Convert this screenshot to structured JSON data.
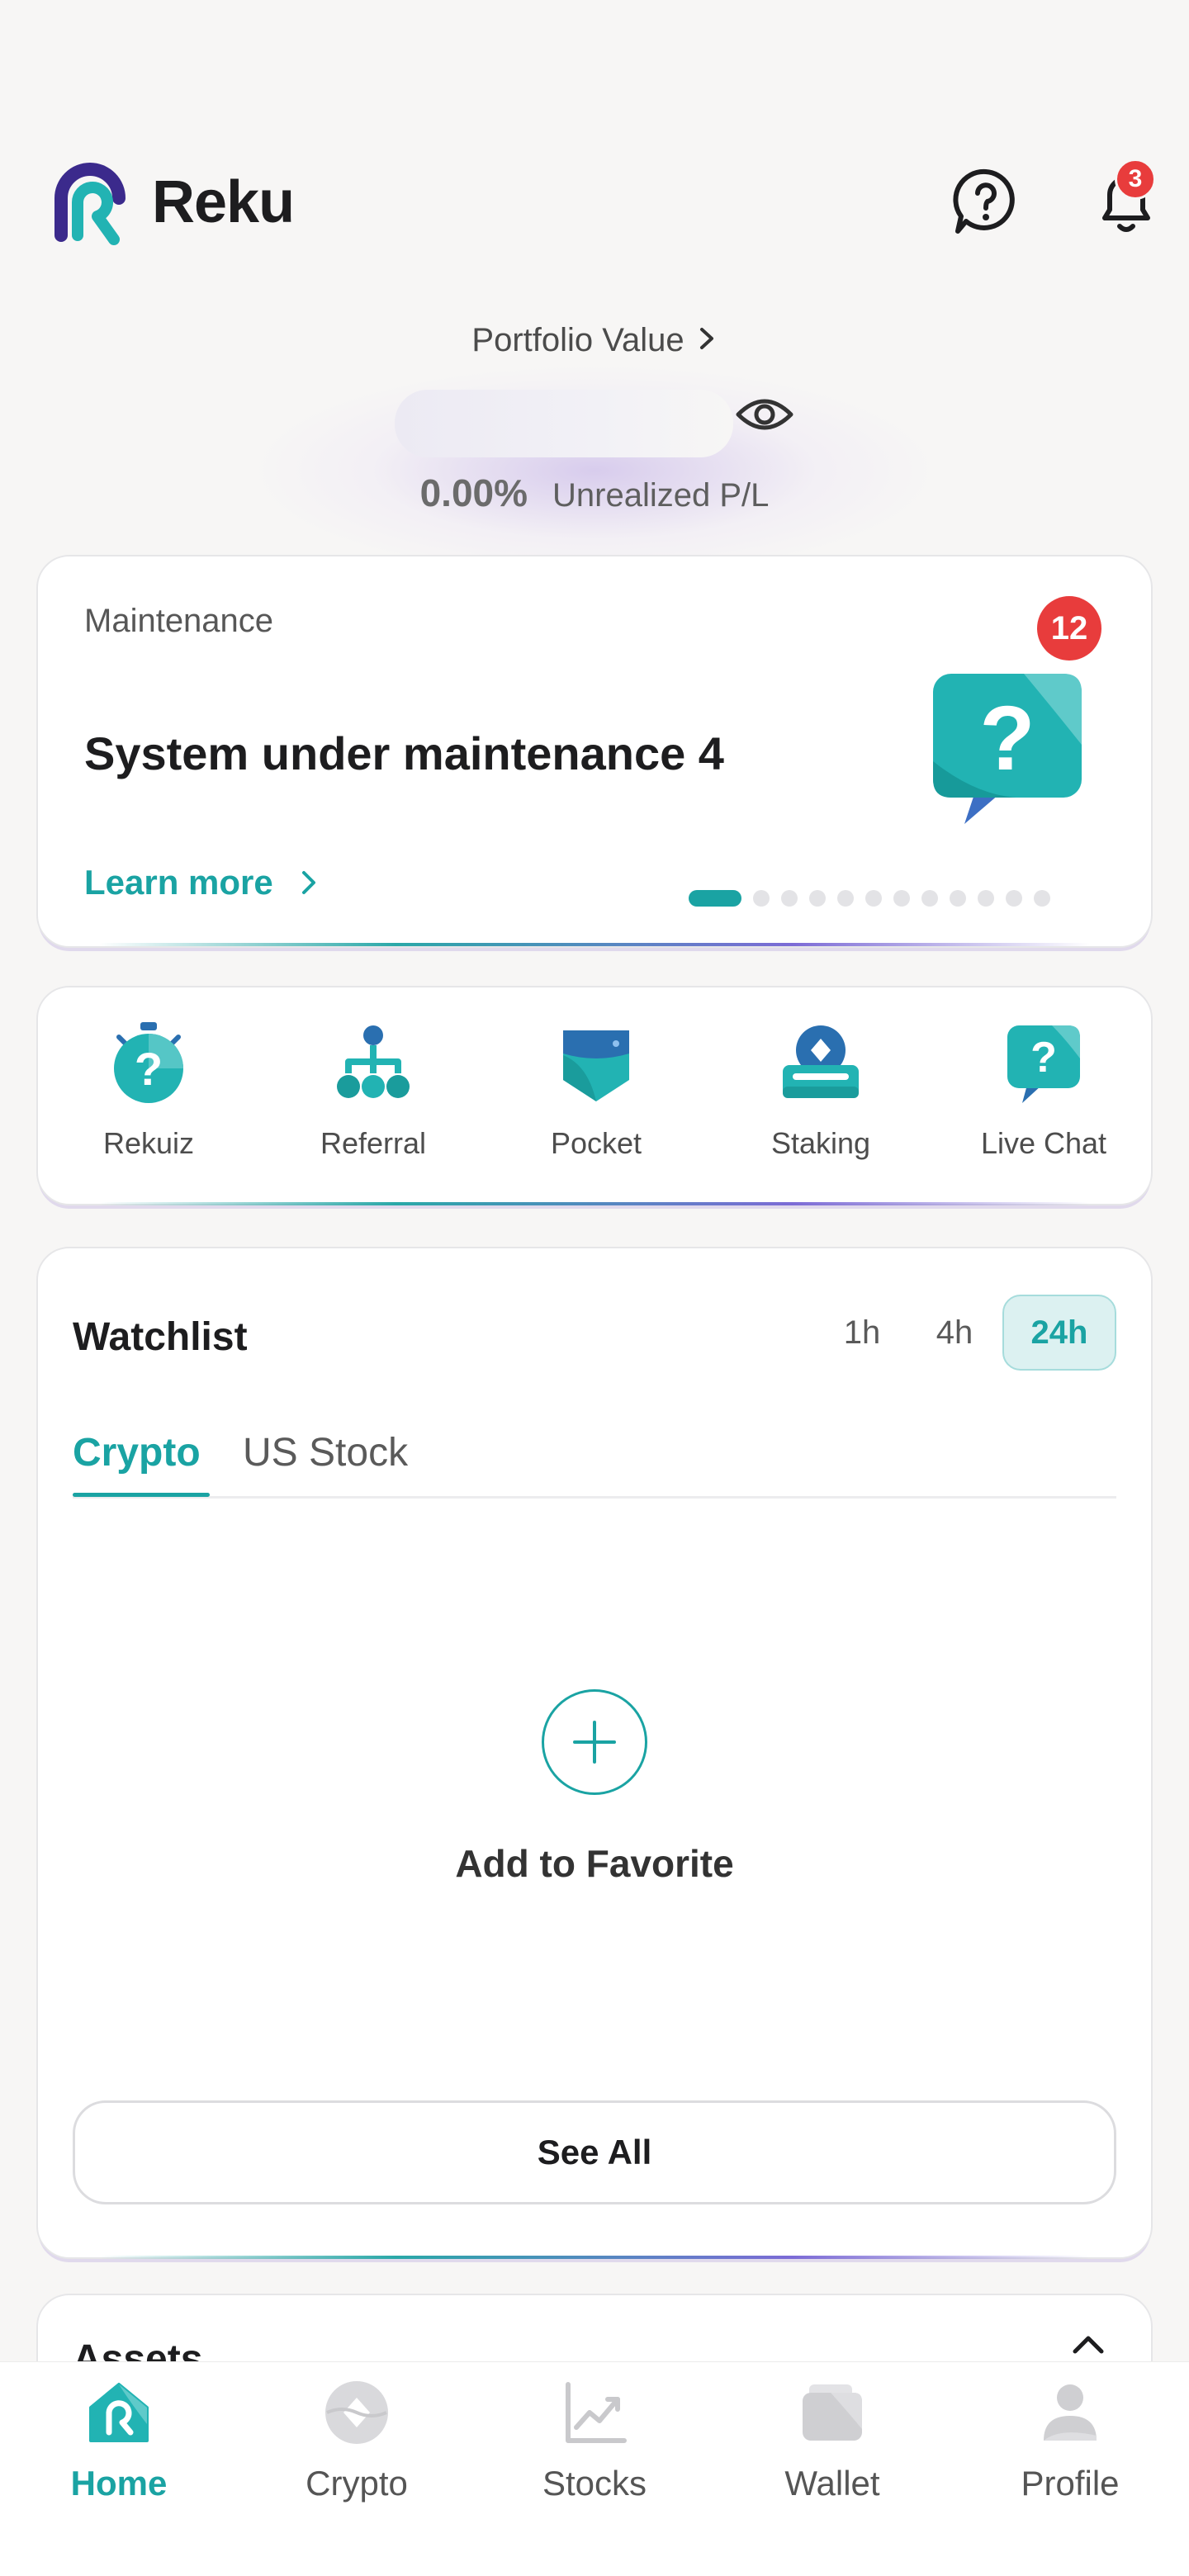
{
  "brand": {
    "name": "Reku",
    "accent": "#1aa3a3"
  },
  "header": {
    "help_icon": "help-chat-icon",
    "notification_icon": "bell-icon",
    "notification_count": "3"
  },
  "portfolio": {
    "title": "Portfolio Value",
    "pl_percent": "0.00%",
    "pl_label": "Unrealized P/L"
  },
  "banner": {
    "label": "Maintenance",
    "badge_count": "12",
    "title": "System under maintenance 4",
    "link": "Learn more",
    "page_count": 12,
    "active_page": 1
  },
  "quick_menu": [
    {
      "label": "Rekuiz",
      "icon": "stopwatch-question-icon"
    },
    {
      "label": "Referral",
      "icon": "network-tree-icon"
    },
    {
      "label": "Pocket",
      "icon": "pocket-icon"
    },
    {
      "label": "Staking",
      "icon": "staking-coin-icon"
    },
    {
      "label": "Live Chat",
      "icon": "live-chat-icon"
    }
  ],
  "watchlist": {
    "title": "Watchlist",
    "timeframes": [
      "1h",
      "4h",
      "24h"
    ],
    "active_timeframe": "24h",
    "tabs": [
      "Crypto",
      "US Stock"
    ],
    "active_tab": "Crypto",
    "empty_label": "Add to Favorite",
    "see_all": "See All"
  },
  "assets": {
    "title": "Assets"
  },
  "bottom_nav": [
    {
      "label": "Home",
      "icon": "home-icon",
      "active": true
    },
    {
      "label": "Crypto",
      "icon": "crypto-coin-icon",
      "active": false
    },
    {
      "label": "Stocks",
      "icon": "stocks-chart-icon",
      "active": false
    },
    {
      "label": "Wallet",
      "icon": "wallet-icon",
      "active": false
    },
    {
      "label": "Profile",
      "icon": "profile-icon",
      "active": false
    }
  ]
}
